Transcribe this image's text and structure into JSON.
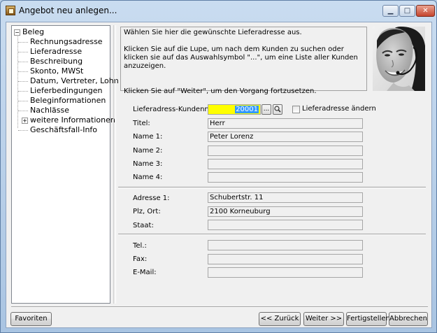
{
  "window": {
    "title": "Angebot neu anlegen...",
    "accent": "#b9d1ea"
  },
  "tree": {
    "root": "Beleg",
    "items": [
      {
        "label": "Rechnungsadresse"
      },
      {
        "label": "Lieferadresse"
      },
      {
        "label": "Beschreibung"
      },
      {
        "label": "Skonto, MWSt"
      },
      {
        "label": "Datum, Vertreter, Lohn"
      },
      {
        "label": "Lieferbedingungen"
      },
      {
        "label": "Beleginformationen"
      },
      {
        "label": "Nachlässe"
      },
      {
        "label": "weitere Informationen",
        "expandable": true
      },
      {
        "label": "Geschäftsfall-Info"
      }
    ]
  },
  "info": {
    "line1": "Wählen Sie hier die gewünschte Lieferadresse aus.",
    "line2": "Klicken Sie auf die Lupe, um nach dem Kunden zu suchen oder klicken sie auf das Auswahlsymbol \"...\", um eine Liste aller Kunden anzuzeigen.",
    "line3": "Klicken Sie auf \"Weiter\", um den Vorgang fortzusetzen."
  },
  "form": {
    "kundennr_label": "Lieferadress-Kundennr.:",
    "kundennr_value": "20001",
    "ellipsis_label": "...",
    "change_label": "Lieferadresse ändern",
    "titel_label": "Titel:",
    "titel_value": "Herr",
    "name1_label": "Name 1:",
    "name1_value": "Peter Lorenz",
    "name2_label": "Name 2:",
    "name2_value": "",
    "name3_label": "Name 3:",
    "name3_value": "",
    "name4_label": "Name 4:",
    "name4_value": "",
    "adresse1_label": "Adresse 1:",
    "adresse1_value": "Schubertstr. 11",
    "plzort_label": "Plz, Ort:",
    "plzort_value": "2100  Korneuburg",
    "staat_label": "Staat:",
    "staat_value": "",
    "tel_label": "Tel.:",
    "tel_value": "",
    "fax_label": "Fax:",
    "fax_value": "",
    "email_label": "E-Mail:",
    "email_value": ""
  },
  "buttons": {
    "favoriten": "Favoriten",
    "zurueck": "<< Zurück",
    "weiter": "Weiter >>",
    "fertigstellen": "Fertigstellen",
    "abbrechen": "Abbrechen"
  },
  "icons": {
    "search": "magnifier-icon",
    "app": "document-icon"
  }
}
